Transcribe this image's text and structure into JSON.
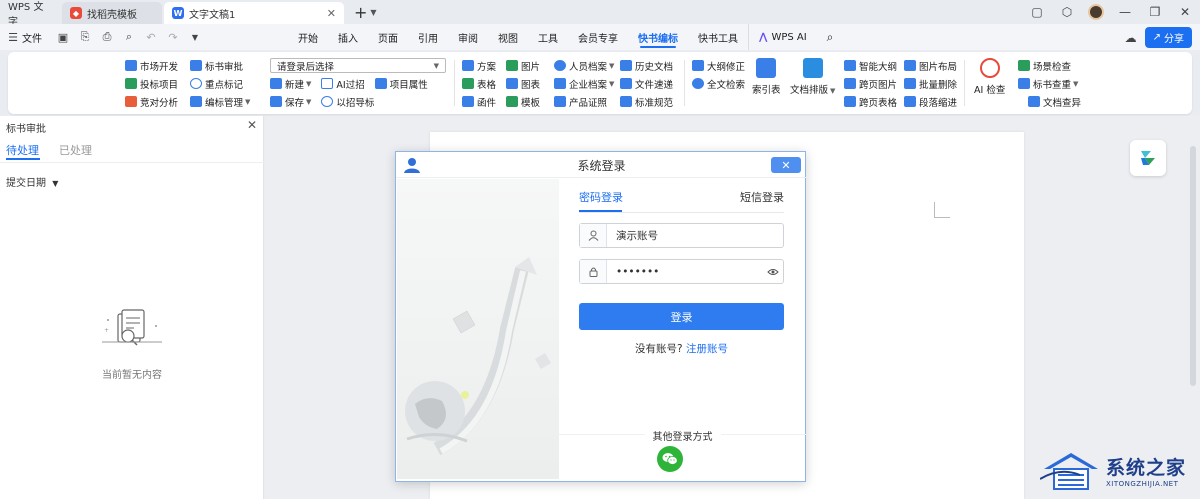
{
  "titlebar": {
    "tabs": [
      {
        "label": "WPS 文字"
      },
      {
        "label": "找稻壳模板"
      },
      {
        "label": "文字文稿1"
      }
    ]
  },
  "menubar": {
    "file_label": "文件",
    "tabs": [
      "开始",
      "插入",
      "页面",
      "引用",
      "审阅",
      "视图",
      "工具",
      "会员专享",
      "快书编标",
      "快书工具",
      "WPS AI"
    ],
    "active_tab": "快书编标",
    "share_label": "分享"
  },
  "ribbon": {
    "col1": [
      "市场开发",
      "投标项目",
      "竞对分析"
    ],
    "col2": [
      "标书审批",
      "重点标记",
      "编标管理"
    ],
    "select_placeholder": "请登录后选择",
    "col3_row2": [
      "新建",
      "AI过招",
      "项目属性"
    ],
    "col3_row3": [
      "保存",
      "以招导标"
    ],
    "col4": [
      "方案",
      "表格",
      "函件"
    ],
    "col5": [
      "图片",
      "图表",
      "模板"
    ],
    "col6": [
      "人员档案",
      "企业档案",
      "产品证照"
    ],
    "col7": [
      "历史文档",
      "文件速递",
      "标准规范"
    ],
    "col8": [
      "大纲修正",
      "全文检索"
    ],
    "big1": "索引表",
    "big2": "文档排版",
    "col9": [
      "智能大纲",
      "跨页图片",
      "跨页表格"
    ],
    "col10": [
      "图片布局",
      "批量删除",
      "段落缩进"
    ],
    "big3": "AI 检查",
    "col11": [
      "场景检查",
      "标书查重",
      "文档查异"
    ]
  },
  "leftpanel": {
    "title": "标书审批",
    "tabs": [
      "待处理",
      "已处理"
    ],
    "filter_label": "提交日期",
    "empty_text": "当前暂无内容"
  },
  "login": {
    "title": "系统登录",
    "tab_password": "密码登录",
    "tab_sms": "短信登录",
    "account_value": "演示账号",
    "password_value": "•••••••",
    "login_button": "登录",
    "no_account": "没有账号?",
    "register_link": "注册账号",
    "other_methods": "其他登录方式"
  },
  "watermark": {
    "name": "系统之家",
    "domain": "XITONGZHIJIA.NET"
  },
  "colors": {
    "accent": "#1d6ff2",
    "wechat": "#2eb539",
    "close": "#4f8ff0"
  }
}
